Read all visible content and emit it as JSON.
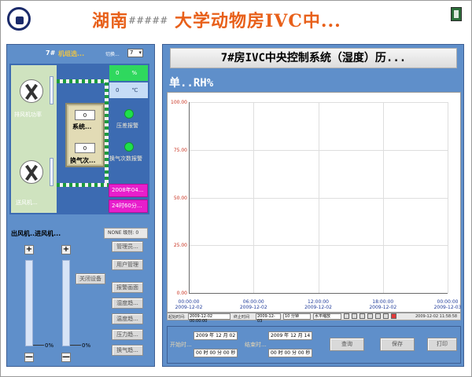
{
  "header": {
    "title_part1": "湖南",
    "title_hash": "#####",
    "title_part2": "大学动物房IVC中...",
    "logo_icon": "company-logo-icon",
    "exit_icon": "exit-door-icon"
  },
  "left": {
    "room_label": "7#",
    "room_status": "机组选...",
    "switch_label": "切换...",
    "room_select": "7",
    "exhaust_fan_label": "排风机功率",
    "supply_fan_label": "送风机...",
    "humidity_value": "0",
    "humidity_unit": "%",
    "temp_value": "0",
    "temp_unit": "℃",
    "system_value": "0",
    "system_label": "系统...",
    "airchange_value": "0",
    "airchange_label": "换气次...",
    "pressure_alarm": "压差报警",
    "airchange_alarm": "换气次数报警",
    "date_value": "2008年04...",
    "time_value": "24时60分...",
    "section_label": "出风机..进风机...",
    "user_badge": "NONE 级别: 0",
    "buttons": {
      "admin": "管理员...",
      "user_mgmt": "用户管理",
      "close_device": "关闭设备",
      "alarm_screen": "报警画面",
      "humidity_trend": "湿度趋...",
      "temp_trend": "温度趋...",
      "pressure_trend": "压力趋...",
      "airchange_trend": "换气趋..."
    },
    "plus": "+",
    "minus": "—",
    "slider1_value": "0%",
    "slider2_value": "0%"
  },
  "right": {
    "chart_title": "7#房IVC中央控制系统（湿度）历...",
    "unit_label": "单..RH%",
    "status": {
      "start_label": "起始时间:",
      "start_value": "2009-12-02 00:00:00",
      "end_label": "终止时间",
      "end_value": "2009-12-03",
      "interval": "10 分钟",
      "scale": "水平缩放",
      "current_time": "2009-12-02 11:58:58"
    },
    "start_time_label": "开始时...",
    "end_time_label": "结束时...",
    "start_date": "2009 年 12 月 02",
    "start_time": "00 时 00 分 00 秒",
    "end_date": "2009 年 12 月 14",
    "end_time": "00 时 00 分 00 秒",
    "query_button": "查询",
    "save_button": "保存",
    "print_button": "打印"
  },
  "chart_data": {
    "type": "line",
    "title": "7#房IVC中央控制系统（湿度）历...",
    "ylabel": "单..RH%",
    "ylim": [
      0,
      100
    ],
    "yticks": [
      "100.00",
      "75.00",
      "50.00",
      "25.00",
      "0.00"
    ],
    "x": [
      {
        "time": "00:00:00",
        "date": "2009-12-02"
      },
      {
        "time": "06:00:00",
        "date": "2009-12-02"
      },
      {
        "time": "12:00:00",
        "date": "2009-12-02"
      },
      {
        "time": "18:00:00",
        "date": "2009-12-02"
      },
      {
        "time": "00:00:00",
        "date": "2009-12-03"
      }
    ],
    "series": [],
    "grid": true
  }
}
